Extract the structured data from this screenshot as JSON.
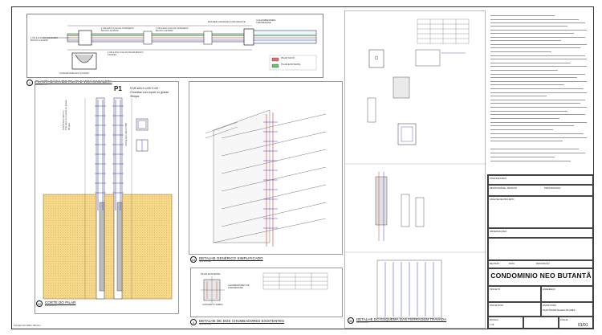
{
  "sheet": {
    "project_name": "CONDOMINIO NEO BUTANTÃ",
    "sheet_number": "01/01",
    "footer_note": "Formato A0 1189 x 841mm"
  },
  "views": {
    "v1": {
      "number": "1",
      "title": "PLANTA BAIXA DO PILAR E VIGA CANALETA",
      "scale": "ESCALA 1:50"
    },
    "v2": {
      "number": "02",
      "title": "CORTE DO PILAR",
      "scale": "ESCALA 1:25"
    },
    "v3": {
      "number": "03",
      "title": "DETALHE GENÉRICO SIMPLIFICADO",
      "scale": "SEM ESCALA"
    },
    "v4": {
      "number": "4",
      "title": "DETALHE DE DOS CHUMBADORES EXISTENTES",
      "scale": "SEM ESCALA"
    },
    "v5": {
      "number": "05",
      "title": "DETALHE DO ESQUEMA DAS FERRAGEM TRAVADA",
      "scale": "SEM ESCALA"
    }
  },
  "plan": {
    "label_chumbador": "4 CHUMBADORES\nTRANSPASSE",
    "legend": [
      {
        "label": "PILAR NOVO",
        "color": "#e36b6b"
      },
      {
        "label": "PILAR EXISTENTE",
        "color": "#6bbf6b"
      }
    ],
    "callouts": [
      "1 N6 ø16 C/ 10 CANALETA BLOCO 14/19/29",
      "1 N6 ø16.0 C/12 AO CANALETA BLOCO 14/19/29",
      "1 N6 ø16.0 C/12 AO CANALETA BLOCO 14/19/29",
      "1 N6 ø16.0 C/12 AO PILAR BLOCO 14/19/29",
      "ENCHER CANALETA COM GRAUTE",
      "CANALETA BLOCO 14/19/29"
    ]
  },
  "section": {
    "pillar_label": "P1",
    "spec_top": "5 N5 ø16.0 c/26 C=52",
    "spec_note": "Chumbar com epoxi ou graute",
    "spec_mpa": "30mpa",
    "vertical_left": "5 N2 ø16.0 c/26 C=...\nChumbar com epoxi ou graute\n30mpa",
    "vertical_right": "4 N1 ø16.0 c/26 C=450"
  },
  "detail4": {
    "existing_label": "PILAR EXISTENTE",
    "chumbador_label": "CHUMBADORES DE TRANSPASSE",
    "concrete_label": "CONCRETO 30MPA"
  },
  "title_block": {
    "field_owner": "PROPRIETÁRIO",
    "field_tech": "RESPONSÁVEL TÉCNICO",
    "field_project": "ANÁLISE DE PROJETO",
    "field_prof": "PROFISSIONAL",
    "field_notes": "OBSERVAÇÕES",
    "field_revision": "REVISÃO",
    "field_date": "DATA",
    "field_description": "DESCRIÇÃO",
    "field_author": "PROJETISTA",
    "field_discipline": "ESTRUTURA",
    "field_content": "PLANTAS/DETALHES PILARES",
    "field_scale": "ESCALA",
    "field_scale_val": "1:25",
    "field_sheet": "FOLHA",
    "field_project_label": "PROJETO",
    "field_address": "ENDEREÇO"
  }
}
